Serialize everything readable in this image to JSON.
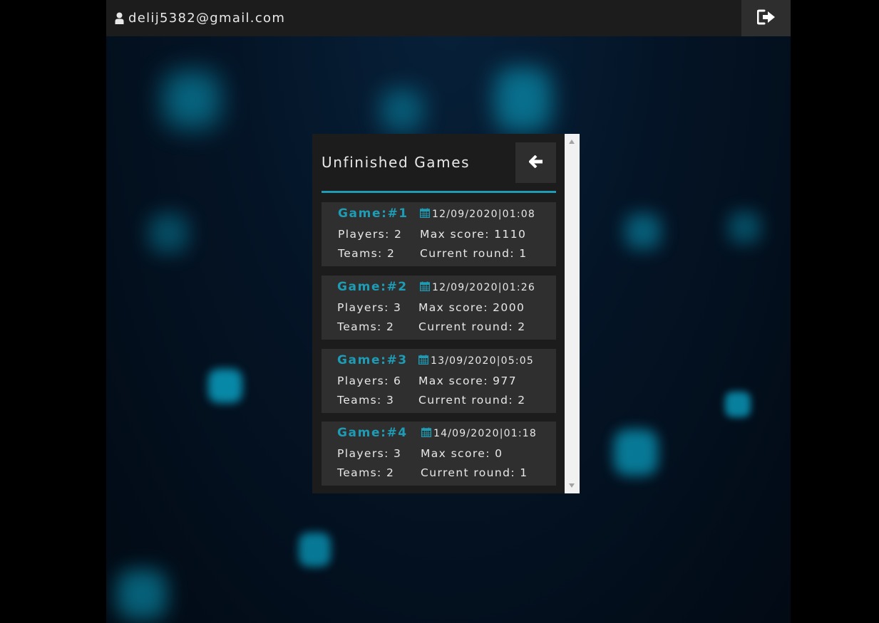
{
  "user": {
    "email": "delij5382@gmail.com"
  },
  "icons": {
    "user": "user-icon",
    "logout": "sign-out-icon",
    "back": "arrow-left-icon",
    "calendar": "calendar-icon"
  },
  "colors": {
    "accent": "#1e9cb5",
    "topbar": "#1c1c1c",
    "card": "#2f2f2f",
    "text": "#e8e8e8"
  },
  "panel": {
    "title": "Unfinished Games"
  },
  "games": [
    {
      "title": "Game:#1",
      "date": "12/09/2020|01:08",
      "players": "Players: 2",
      "max_score": "Max score: 1110",
      "teams": "Teams: 2",
      "current_round": "Current round: 1"
    },
    {
      "title": "Game:#2",
      "date": "12/09/2020|01:26",
      "players": "Players: 3",
      "max_score": "Max score: 2000",
      "teams": "Teams: 2",
      "current_round": "Current round: 2"
    },
    {
      "title": "Game:#3",
      "date": "13/09/2020|05:05",
      "players": "Players: 6",
      "max_score": "Max score: 977",
      "teams": "Teams: 3",
      "current_round": "Current round: 2"
    },
    {
      "title": "Game:#4",
      "date": "14/09/2020|01:18",
      "players": "Players: 3",
      "max_score": "Max score: 0",
      "teams": "Teams: 2",
      "current_round": "Current round: 1"
    }
  ]
}
